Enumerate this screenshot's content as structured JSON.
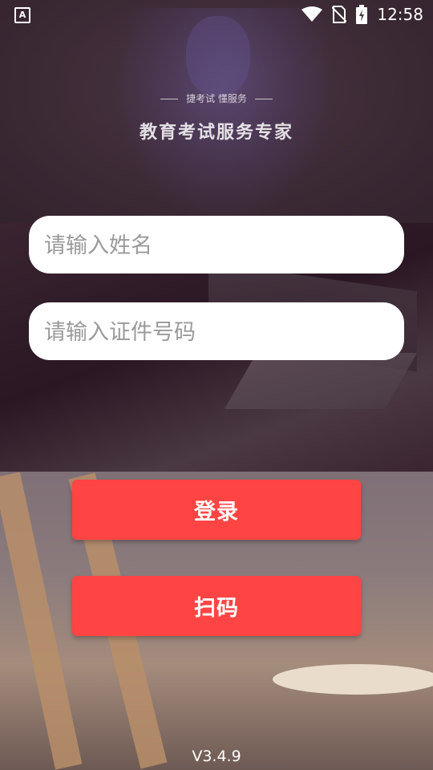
{
  "status_bar": {
    "left_icon": "accessibility-a-icon",
    "left_icon_text": "A",
    "icons": [
      "wifi-icon",
      "no-sim-icon",
      "battery-charging-icon"
    ],
    "time": "12:58"
  },
  "banner": {
    "tagline": "捷考试 懂服务",
    "title": "教育考试服务专家"
  },
  "form": {
    "name_placeholder": "请输入姓名",
    "name_value": "",
    "id_placeholder": "请输入证件号码",
    "id_value": ""
  },
  "buttons": {
    "login_label": "登录",
    "scan_label": "扫码"
  },
  "footer": {
    "version": "V3.4.9"
  },
  "colors": {
    "button_bg": "#ff4444",
    "input_bg": "#ffffff"
  }
}
